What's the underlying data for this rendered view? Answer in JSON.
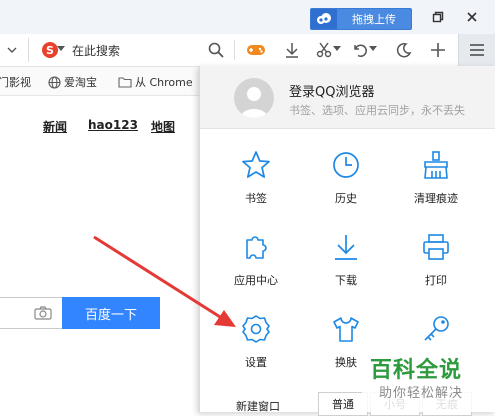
{
  "titlebar": {
    "cloud_label": "拖拽上传"
  },
  "toolbar": {
    "search_engine_text": "在此搜索"
  },
  "bookmarks": [
    {
      "label": "门影视"
    },
    {
      "label": "爱淘宝"
    },
    {
      "label": "从 Chrome"
    }
  ],
  "page": {
    "nav": [
      "新闻",
      "hao123",
      "地图"
    ],
    "search_button": "百度一下"
  },
  "menu": {
    "login_title": "登录QQ浏览器",
    "login_sub": "书签、选项、应用云同步，永不丢失",
    "items": [
      {
        "label": "书签",
        "icon": "star-icon"
      },
      {
        "label": "历史",
        "icon": "clock-icon"
      },
      {
        "label": "清理痕迹",
        "icon": "broom-icon"
      },
      {
        "label": "应用中心",
        "icon": "puzzle-icon"
      },
      {
        "label": "下载",
        "icon": "download-icon"
      },
      {
        "label": "打印",
        "icon": "printer-icon"
      },
      {
        "label": "设置",
        "icon": "gear-icon"
      },
      {
        "label": "换肤",
        "icon": "tshirt-icon"
      },
      {
        "label": "",
        "icon": "key-icon"
      }
    ],
    "new_window": "新建窗口",
    "modes": [
      "普通",
      "小号",
      "无痕"
    ]
  },
  "watermark": {
    "big": "百科全说",
    "small": "助你轻松解决"
  },
  "colors": {
    "accent": "#1e88e5",
    "search_btn": "#3385ff",
    "arrow": "#e53935"
  }
}
